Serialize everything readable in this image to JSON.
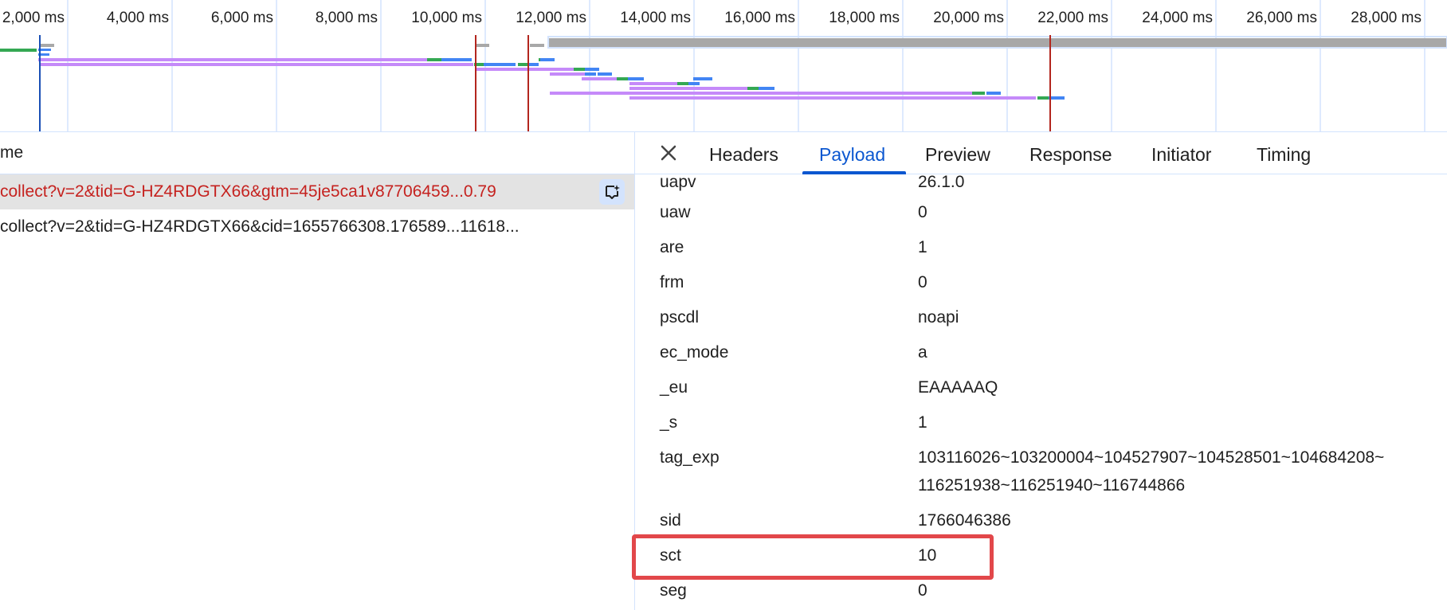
{
  "overview": {
    "tick_labels": [
      "2,000 ms",
      "4,000 ms",
      "6,000 ms",
      "8,000 ms",
      "10,000 ms",
      "12,000 ms",
      "14,000 ms",
      "16,000 ms",
      "18,000 ms",
      "20,000 ms",
      "22,000 ms",
      "24,000 ms",
      "26,000 ms",
      "28,000 ms"
    ],
    "colors": {
      "grid": "#d3e3fd",
      "waiting": "#c58af9",
      "queued": "#a8a8a8",
      "download": "#4285f4",
      "connect": "#34a853",
      "load_marker": "#b3261e",
      "dcl_marker": "#1a4fb5"
    }
  },
  "requests": {
    "column_header": "me",
    "rows": [
      {
        "text": "collect?v=2&tid=G-HZ4RDGTX66&gtm=45je5ca1v87706459...0.79"
      },
      {
        "text": "collect?v=2&tid=G-HZ4RDGTX66&cid=1655766308.176589...11618..."
      }
    ]
  },
  "tabs": {
    "close_icon": "close-icon",
    "items": [
      "Headers",
      "Payload",
      "Preview",
      "Response",
      "Initiator",
      "Timing"
    ],
    "active": "Payload"
  },
  "payload": [
    {
      "key": "uapv",
      "value": "26.1.0"
    },
    {
      "key": "uaw",
      "value": "0"
    },
    {
      "key": "are",
      "value": "1"
    },
    {
      "key": "frm",
      "value": "0"
    },
    {
      "key": "pscdl",
      "value": "noapi"
    },
    {
      "key": "ec_mode",
      "value": "a"
    },
    {
      "key": "_eu",
      "value": "EAAAAAQ"
    },
    {
      "key": "_s",
      "value": "1"
    },
    {
      "key": "tag_exp",
      "value": "103116026~103200004~104527907~104528501~104684208~",
      "value2": "116251938~116251940~116744866"
    },
    {
      "key": "sid",
      "value": "1766046386"
    },
    {
      "key": "sct",
      "value": "10"
    },
    {
      "key": "seg",
      "value": "0"
    }
  ],
  "highlight_color": "#e2474a"
}
